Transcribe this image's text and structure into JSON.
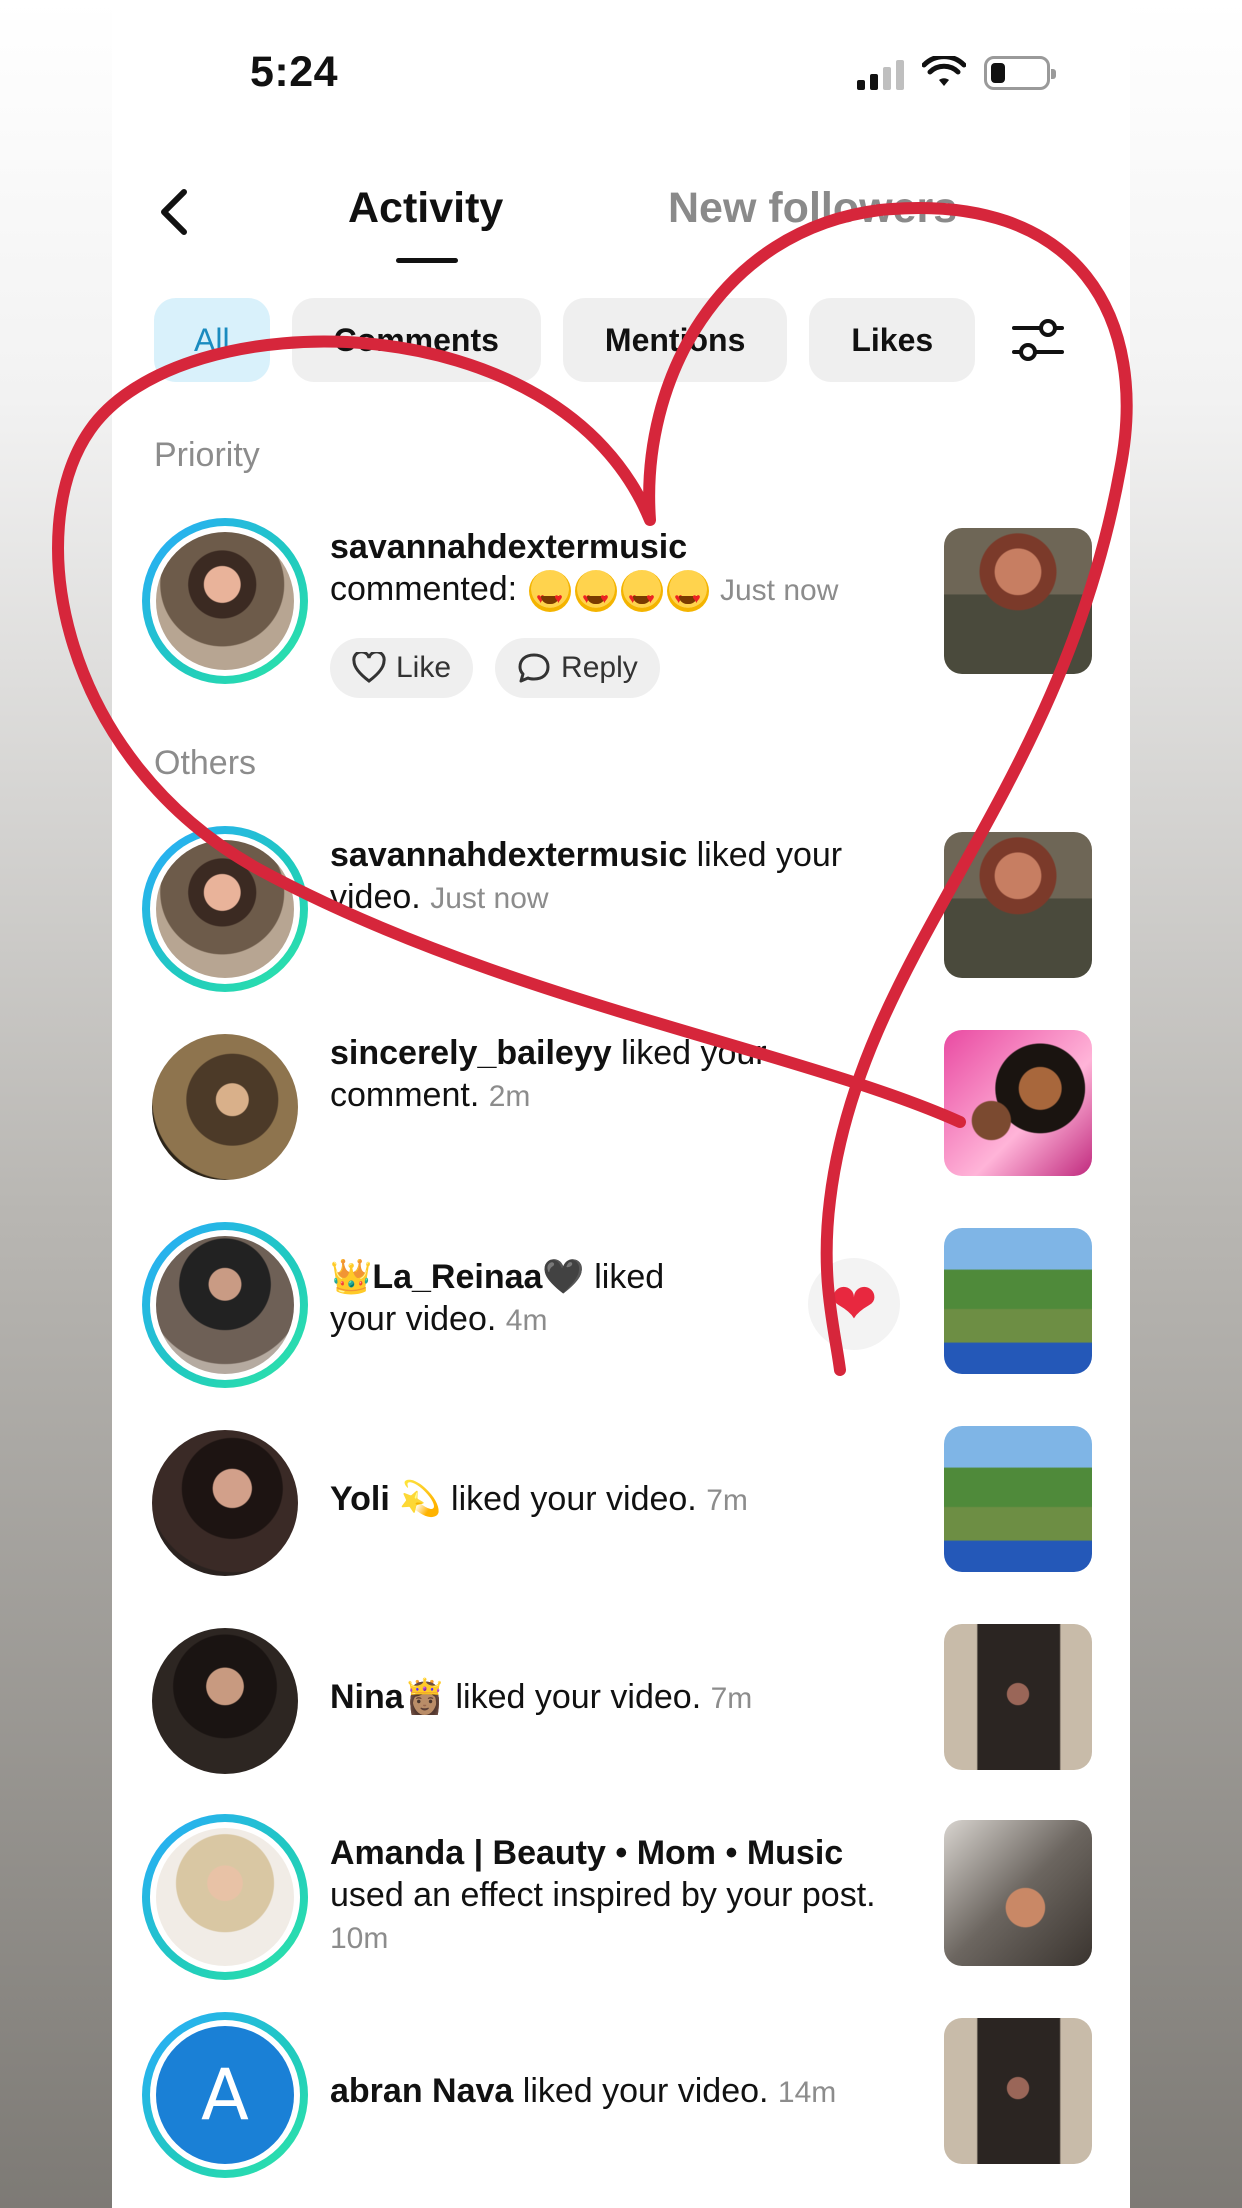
{
  "status_bar": {
    "time": "5:24"
  },
  "header": {
    "tab_activity": "Activity",
    "tab_new_followers": "New followers"
  },
  "chips": [
    "All",
    "Comments",
    "Mentions",
    "Likes"
  ],
  "sections": {
    "priority": "Priority",
    "others": "Others"
  },
  "priority_item": {
    "username": "savannahdextermusic",
    "action": "commented:",
    "time": "Just now",
    "like_label": "Like",
    "reply_label": "Reply"
  },
  "items": [
    {
      "username": "savannahdextermusic",
      "action": " liked your video.",
      "time": "Just now"
    },
    {
      "username": "sincerely_baileyy",
      "action": " liked your comment.",
      "time": "2m"
    },
    {
      "username": "👑La_Reinaa🖤",
      "action": " liked your video.",
      "time": "4m"
    },
    {
      "username": "Yoli 💫",
      "action": " liked your video.",
      "time": "7m"
    },
    {
      "username": "Nina👸🏽",
      "action": " liked your video.",
      "time": "7m"
    },
    {
      "username": "Amanda | Beauty • Mom • Music",
      "action": " used an effect inspired by your post.",
      "time": "10m"
    },
    {
      "username": "abran Nava",
      "action": " liked your video.",
      "time": "14m",
      "avatar_letter": "A"
    }
  ],
  "colors": {
    "accent": "#1a8bbf",
    "ring_start": "#2aa9ff",
    "ring_end": "#2ee6a6",
    "heart_stroke": "#d6263b"
  }
}
